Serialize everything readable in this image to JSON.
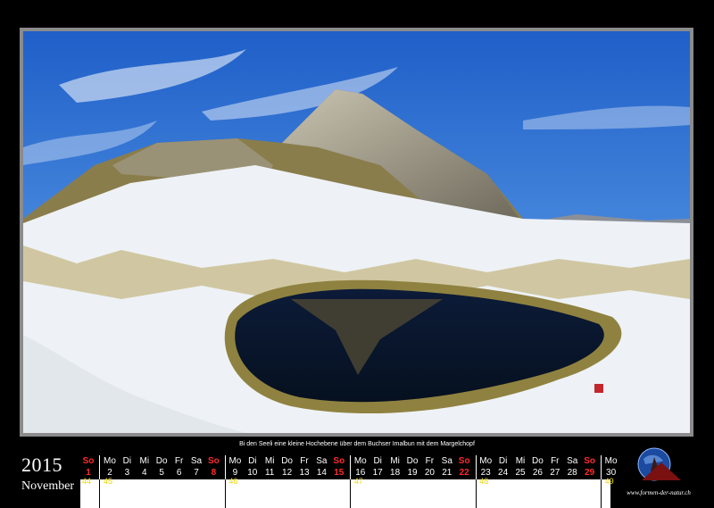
{
  "caption": "Bi den Seeli eine kleine Hochebene über dem Buchser Imalbun mit dem Margelchopf",
  "year": "2015",
  "month": "November",
  "calendar": {
    "groups": [
      {
        "days": [
          "So"
        ],
        "dates": [
          "1"
        ],
        "red": [
          true
        ],
        "week": "44"
      },
      {
        "days": [
          "Mo",
          "Di",
          "Mi",
          "Do",
          "Fr",
          "Sa",
          "So"
        ],
        "dates": [
          "2",
          "3",
          "4",
          "5",
          "6",
          "7",
          "8"
        ],
        "red": [
          false,
          false,
          false,
          false,
          false,
          false,
          true
        ],
        "week": "45"
      },
      {
        "days": [
          "Mo",
          "Di",
          "Mi",
          "Do",
          "Fr",
          "Sa",
          "So"
        ],
        "dates": [
          "9",
          "10",
          "11",
          "12",
          "13",
          "14",
          "15"
        ],
        "red": [
          false,
          false,
          false,
          false,
          false,
          false,
          true
        ],
        "week": "46"
      },
      {
        "days": [
          "Mo",
          "Di",
          "Mi",
          "Do",
          "Fr",
          "Sa",
          "So"
        ],
        "dates": [
          "16",
          "17",
          "18",
          "19",
          "20",
          "21",
          "22"
        ],
        "red": [
          false,
          false,
          false,
          false,
          false,
          false,
          true
        ],
        "week": "47"
      },
      {
        "days": [
          "Mo",
          "Di",
          "Mi",
          "Do",
          "Fr",
          "Sa",
          "So"
        ],
        "dates": [
          "23",
          "24",
          "25",
          "26",
          "27",
          "28",
          "29"
        ],
        "red": [
          false,
          false,
          false,
          false,
          false,
          false,
          true
        ],
        "week": "48"
      },
      {
        "days": [
          "Mo"
        ],
        "dates": [
          "30"
        ],
        "red": [
          false
        ],
        "week": "49"
      }
    ]
  },
  "logo": {
    "text": "www.formen-der-natur.ch"
  },
  "colors": {
    "sunday": "#ff2a2a",
    "week_number": "#e8d600",
    "background": "#000000"
  }
}
